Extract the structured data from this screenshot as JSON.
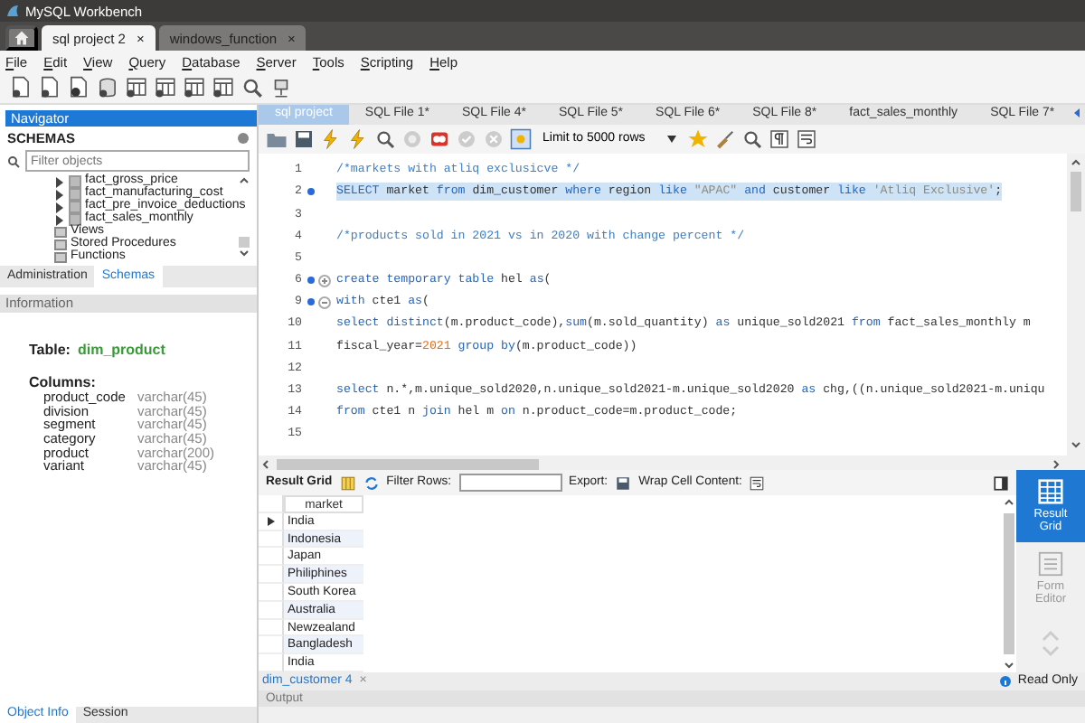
{
  "window": {
    "title": "MySQL Workbench"
  },
  "connection_tabs": [
    {
      "label": "sql project 2",
      "close": "×",
      "selected": true
    },
    {
      "label": "windows_function",
      "close": "×",
      "selected": false
    }
  ],
  "menu": [
    "File",
    "Edit",
    "View",
    "Query",
    "Database",
    "Server",
    "Tools",
    "Scripting",
    "Help"
  ],
  "navigator": {
    "title": "Navigator",
    "schemas_label": "SCHEMAS",
    "filter_placeholder": "Filter objects",
    "tree": [
      {
        "label": "fact_gross_price",
        "kind": "table",
        "expanded": false
      },
      {
        "label": "fact_manufacturing_cost",
        "kind": "table",
        "expanded": false
      },
      {
        "label": "fact_pre_invoice_deductions",
        "kind": "table",
        "expanded": false
      },
      {
        "label": "fact_sales_monthly",
        "kind": "table",
        "expanded": false
      },
      {
        "label": "Views",
        "kind": "folder"
      },
      {
        "label": "Stored Procedures",
        "kind": "folder"
      },
      {
        "label": "Functions",
        "kind": "folder"
      }
    ],
    "tabs": [
      {
        "label": "Administration",
        "selected": false
      },
      {
        "label": "Schemas",
        "selected": true
      }
    ]
  },
  "information": {
    "title": "Information",
    "table_label": "Table:",
    "table_name": "dim_product",
    "columns_label": "Columns:",
    "columns": [
      {
        "name": "product_code",
        "type": "varchar(45)"
      },
      {
        "name": "division",
        "type": "varchar(45)"
      },
      {
        "name": "segment",
        "type": "varchar(45)"
      },
      {
        "name": "category",
        "type": "varchar(45)"
      },
      {
        "name": "product",
        "type": "varchar(200)"
      },
      {
        "name": "variant",
        "type": "varchar(45)"
      }
    ],
    "tabs": [
      {
        "label": "Object Info",
        "selected": true
      },
      {
        "label": "Session",
        "selected": false
      }
    ]
  },
  "sql_tabs": [
    {
      "label": "sql project",
      "selected": true
    },
    {
      "label": "SQL File 1*",
      "selected": false
    },
    {
      "label": "SQL File 4*",
      "selected": false
    },
    {
      "label": "SQL File 5*",
      "selected": false
    },
    {
      "label": "SQL File 6*",
      "selected": false
    },
    {
      "label": "SQL File 8*",
      "selected": false
    },
    {
      "label": "fact_sales_monthly",
      "selected": false
    },
    {
      "label": "SQL File 7*",
      "selected": false
    }
  ],
  "limit_select": "Limit to 5000 rows",
  "code_lines": [
    {
      "number": "1",
      "marker": false,
      "selected": false,
      "tokens": [
        {
          "kind": "comment",
          "text": "/*markets with atliq exclusicve */"
        }
      ]
    },
    {
      "number": "2",
      "marker": true,
      "selected": true,
      "tokens": [
        {
          "kind": "keyword",
          "text": "SELECT"
        },
        {
          "kind": "plain",
          "text": " market "
        },
        {
          "kind": "keyword",
          "text": "from"
        },
        {
          "kind": "plain",
          "text": " dim_customer "
        },
        {
          "kind": "keyword",
          "text": "where"
        },
        {
          "kind": "plain",
          "text": " region "
        },
        {
          "kind": "keyword",
          "text": "like"
        },
        {
          "kind": "string",
          "text": " \"APAC\" "
        },
        {
          "kind": "keyword",
          "text": "and"
        },
        {
          "kind": "plain",
          "text": " customer "
        },
        {
          "kind": "keyword",
          "text": "like"
        },
        {
          "kind": "string",
          "text": " 'Atliq Exclusive'"
        },
        {
          "kind": "plain",
          "text": ";"
        }
      ]
    },
    {
      "number": "3",
      "marker": false,
      "selected": false
    },
    {
      "number": "4",
      "marker": false,
      "selected": false,
      "tokens": [
        {
          "kind": "comment",
          "text": "/*products sold in 2021 vs in 2020 with change percent */"
        }
      ]
    },
    {
      "number": "5",
      "marker": false,
      "selected": false
    },
    {
      "number": "6",
      "marker": true,
      "folded": true,
      "selected": false,
      "tokens": [
        {
          "kind": "keyword",
          "text": "create temporary table"
        },
        {
          "kind": "plain",
          "text": " hel "
        },
        {
          "kind": "keyword",
          "text": "as"
        },
        {
          "kind": "plain",
          "text": "("
        }
      ]
    },
    {
      "number": "9",
      "marker": true,
      "folded": false,
      "selected": false,
      "tokens": [
        {
          "kind": "keyword",
          "text": "with"
        },
        {
          "kind": "plain",
          "text": " cte1 "
        },
        {
          "kind": "keyword",
          "text": "as"
        },
        {
          "kind": "plain",
          "text": "("
        }
      ]
    },
    {
      "number": "10",
      "marker": false,
      "selected": false,
      "tokens": [
        {
          "kind": "keyword",
          "text": "select distinct"
        },
        {
          "kind": "plain",
          "text": "(m.product_code),"
        },
        {
          "kind": "keyword",
          "text": "sum"
        },
        {
          "kind": "plain",
          "text": "(m.sold_quantity) "
        },
        {
          "kind": "keyword",
          "text": "as"
        },
        {
          "kind": "plain",
          "text": " unique_sold2021 "
        },
        {
          "kind": "keyword",
          "text": "from"
        },
        {
          "kind": "plain",
          "text": " fact_sales_monthly m"
        }
      ]
    },
    {
      "number": "11",
      "marker": false,
      "selected": false,
      "tokens": [
        {
          "kind": "plain",
          "text": "fiscal_year="
        },
        {
          "kind": "number",
          "text": "2021"
        },
        {
          "kind": "keyword",
          "text": " group by"
        },
        {
          "kind": "plain",
          "text": "(m.product_code))"
        }
      ]
    },
    {
      "number": "12",
      "marker": false,
      "selected": false
    },
    {
      "number": "13",
      "marker": false,
      "selected": false,
      "tokens": [
        {
          "kind": "keyword",
          "text": "select"
        },
        {
          "kind": "plain",
          "text": " n.*,m.unique_sold2020,n.unique_sold2021-m.unique_sold2020 "
        },
        {
          "kind": "keyword",
          "text": "as"
        },
        {
          "kind": "plain",
          "text": " chg,((n.unique_sold2021-m.uniqu"
        }
      ]
    },
    {
      "number": "14",
      "marker": false,
      "selected": false,
      "tokens": [
        {
          "kind": "keyword",
          "text": "from"
        },
        {
          "kind": "plain",
          "text": " cte1 n "
        },
        {
          "kind": "keyword",
          "text": "join"
        },
        {
          "kind": "plain",
          "text": " hel m "
        },
        {
          "kind": "keyword",
          "text": "on"
        },
        {
          "kind": "plain",
          "text": " n.product_code=m.product_code;"
        }
      ]
    },
    {
      "number": "15",
      "marker": false,
      "selected": false
    }
  ],
  "result": {
    "grid_label": "Result Grid",
    "filter_label": "Filter Rows:",
    "export_label": "Export:",
    "wrap_label": "Wrap Cell Content:",
    "columns": [
      "market"
    ],
    "rows": [
      {
        "cells": [
          "India"
        ],
        "current": true
      },
      {
        "cells": [
          "Indonesia"
        ],
        "current": false
      },
      {
        "cells": [
          "Japan"
        ],
        "current": false
      },
      {
        "cells": [
          "Philiphines"
        ],
        "current": false
      },
      {
        "cells": [
          "South Korea"
        ],
        "current": false
      },
      {
        "cells": [
          "Australia"
        ],
        "current": false
      },
      {
        "cells": [
          "Newzealand"
        ],
        "current": false
      },
      {
        "cells": [
          "Bangladesh"
        ],
        "current": false
      },
      {
        "cells": [
          "India"
        ],
        "current": false
      }
    ],
    "side": [
      {
        "label": "Result Grid",
        "kind": "grid",
        "selected": true
      },
      {
        "label": "Form Editor",
        "kind": "form",
        "selected": false
      }
    ],
    "tab": {
      "label": "dim_customer 4",
      "close": "×"
    },
    "status": "Read Only"
  },
  "output_label": "Output"
}
